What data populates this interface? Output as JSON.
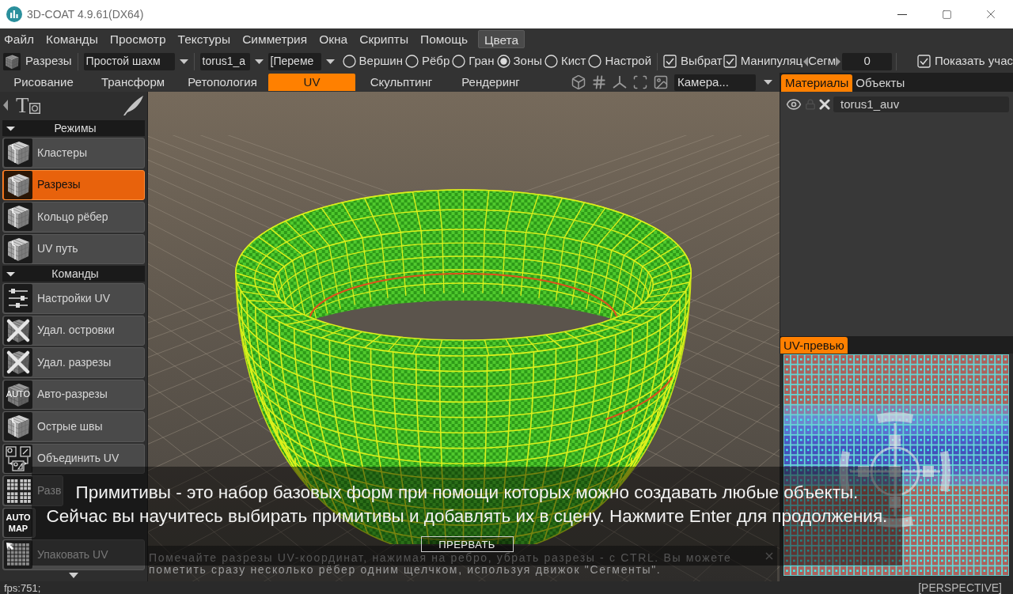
{
  "window": {
    "title": "3D-COAT 4.9.61(DX64)"
  },
  "menu": {
    "items": [
      "Файл",
      "Команды",
      "Просмотр",
      "Текстуры",
      "Симметрия",
      "Окна",
      "Скрипты",
      "Помощь"
    ],
    "button": "Цвета"
  },
  "toolbar": {
    "mode": "Разрезы",
    "dropdowns": [
      "Простой шахм",
      "torus1_a",
      "[Переме"
    ],
    "radios": [
      {
        "label": "Вершин",
        "selected": false
      },
      {
        "label": "Рёбр",
        "selected": false
      },
      {
        "label": "Гран",
        "selected": false
      },
      {
        "label": "Зоны",
        "selected": true
      },
      {
        "label": "Кист",
        "selected": false
      },
      {
        "label": "Настрой",
        "selected": false
      }
    ],
    "checkboxes": [
      {
        "label": "Выбрат",
        "checked": true
      },
      {
        "label": "Манипуляц",
        "checked": true
      }
    ],
    "segments": {
      "label": "Сегм",
      "value": "0"
    },
    "show": {
      "label": "Показать учас",
      "checked": true
    }
  },
  "tabs": [
    {
      "label": "Рисование",
      "selected": false
    },
    {
      "label": "Трансформ",
      "selected": false
    },
    {
      "label": "Ретопология",
      "selected": false
    },
    {
      "label": "UV",
      "selected": true
    },
    {
      "label": "Скульптинг",
      "selected": false
    },
    {
      "label": "Рендеринг",
      "selected": false
    }
  ],
  "camera": {
    "value": "Камера..."
  },
  "left_panel": {
    "tool_glyph": "T",
    "sections": [
      {
        "title": "Режимы",
        "expanded": true,
        "items": [
          {
            "label": "Кластеры",
            "kind": "cube",
            "selected": false
          },
          {
            "label": "Разрезы",
            "kind": "cube",
            "selected": true
          },
          {
            "label": "Кольцо рёбер",
            "kind": "cube",
            "selected": false
          },
          {
            "label": "UV путь",
            "kind": "cube",
            "selected": false
          }
        ]
      },
      {
        "title": "Команды",
        "expanded": true,
        "items": [
          {
            "label": "Настройки UV",
            "kind": "sliders"
          },
          {
            "label": "Удал. островки",
            "kind": "delete"
          },
          {
            "label": "Удал. разрезы",
            "kind": "delete"
          },
          {
            "label": "Авто-разрезы",
            "kind": "auto",
            "icon_text": "AUTO"
          },
          {
            "label": "Острые швы",
            "kind": "cube"
          },
          {
            "label": "Объединить UV",
            "kind": "merge"
          },
          {
            "label": "Разв",
            "kind": "grid"
          },
          {
            "kind": "automap",
            "icon_text": "AUTO MAP"
          },
          {
            "label": "Упаковать UV",
            "kind": "pack"
          }
        ]
      }
    ]
  },
  "right_panel": {
    "tabs": [
      {
        "label": "Материалы",
        "selected": true
      },
      {
        "label": "Объекты",
        "selected": false
      }
    ],
    "materials": [
      {
        "name": "torus1_auv",
        "visible": true,
        "locked": false
      }
    ],
    "preview_tabs": [
      {
        "label": "UV-превью",
        "selected": true
      }
    ]
  },
  "tutorial": {
    "lines": [
      "Примитивы - это набор базовых форм при помощи которых можно создавать любые объекты.",
      "Сейчас вы научитесь выбирать примитивы и добавлять их в сцену. Нажмите Enter для продолжения."
    ],
    "button": "ПРЕРВАТЬ"
  },
  "hint": {
    "lines": [
      "Помечайте разрезы UV-координат, нажимая на ребро, убрать разрезы - с CTRL. Вы можете",
      "пометить сразу несколько рёбер одним щелчком, используя движок \"Сегменты\"."
    ]
  },
  "status_bar": {
    "fps": "fps:751;",
    "projection": "[PERSPECTIVE]"
  }
}
